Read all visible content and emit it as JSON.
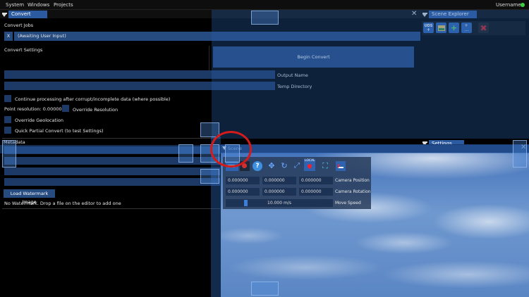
{
  "menu": {
    "items": [
      "System",
      "Windows",
      "Projects"
    ],
    "username": "Username"
  },
  "convert": {
    "tab": "Convert",
    "jobs_label": "Convert Jobs",
    "job_x": "X",
    "job_status": "(Awaiting User Input)",
    "settings_label": "Convert Settings",
    "begin_button": "Begin Convert",
    "output_name": "Output Name",
    "temp_directory": "Temp Directory",
    "continue_processing": "Continue processing after corrupt/incomplete data (where possible)",
    "point_resolution": "Point resolution: 0.000000",
    "override_resolution": "Override Resolution",
    "override_geolocation": "Override Geolocation",
    "quick_partial": "Quick Partial Convert (to test Settings)",
    "metadata_label": "Metadata",
    "load_watermark": "Load Watermark Image",
    "no_watermark": "No Watermark. Drop a file on the editor to add one"
  },
  "scene_explorer": {
    "tab": "Scene Explorer",
    "uds_label": "UDS"
  },
  "settings": {
    "tab": "Settings"
  },
  "scene": {
    "tab": "Scene",
    "local_label": "LOCAL",
    "camera_position": {
      "values": [
        "0.000000",
        "0.000000",
        "0.000000"
      ],
      "label": "Camera Position"
    },
    "camera_rotation": {
      "values": [
        "0.000000",
        "0.000000",
        "0.000000"
      ],
      "label": "Camera Rotation"
    },
    "move_speed": {
      "value": "10.000 m/s",
      "label": "Move Speed"
    }
  },
  "colors": {
    "accent": "#2c5aa0",
    "status_green": "#3ecf3e",
    "delete_red": "#d01f1f"
  }
}
